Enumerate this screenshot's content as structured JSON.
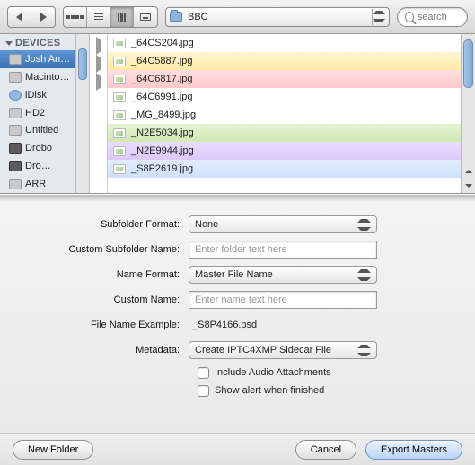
{
  "toolbar": {
    "path_folder": "BBC",
    "search_placeholder": "search"
  },
  "sidebar": {
    "section": "DEVICES",
    "items": [
      {
        "label": "Josh An…",
        "icon": "drive",
        "selected": true
      },
      {
        "label": "Macinto…",
        "icon": "drive"
      },
      {
        "label": "iDisk",
        "icon": "globe"
      },
      {
        "label": "HD2",
        "icon": "drive"
      },
      {
        "label": "Untitled",
        "icon": "drive"
      },
      {
        "label": "Drobo",
        "icon": "drobo"
      },
      {
        "label": "Dro…",
        "icon": "drobo"
      },
      {
        "label": "ARR",
        "icon": "drive"
      }
    ]
  },
  "files": [
    {
      "name": "_64CS204.jpg",
      "color": ""
    },
    {
      "name": "_64C5887.jpg",
      "color": "yellow"
    },
    {
      "name": "_64C6817.jpg",
      "color": "red"
    },
    {
      "name": "_64C6991.jpg",
      "color": ""
    },
    {
      "name": "_MG_8499.jpg",
      "color": ""
    },
    {
      "name": "_N2E5034.jpg",
      "color": "green"
    },
    {
      "name": "_N2E9944.jpg",
      "color": "purple"
    },
    {
      "name": "_S8P2619.jpg",
      "color": "blue"
    }
  ],
  "form": {
    "subfolder_format_label": "Subfolder Format:",
    "subfolder_format_value": "None",
    "custom_subfolder_label": "Custom Subfolder Name:",
    "custom_subfolder_placeholder": "Enter folder text here",
    "name_format_label": "Name Format:",
    "name_format_value": "Master File Name",
    "custom_name_label": "Custom Name:",
    "custom_name_placeholder": "Enter name text here",
    "example_label": "File Name Example:",
    "example_value": "_S8P4166.psd",
    "metadata_label": "Metadata:",
    "metadata_value": "Create IPTC4XMP Sidecar File",
    "include_audio": "Include Audio Attachments",
    "show_alert": "Show alert when finished"
  },
  "footer": {
    "new_folder": "New Folder",
    "cancel": "Cancel",
    "export": "Export Masters"
  }
}
